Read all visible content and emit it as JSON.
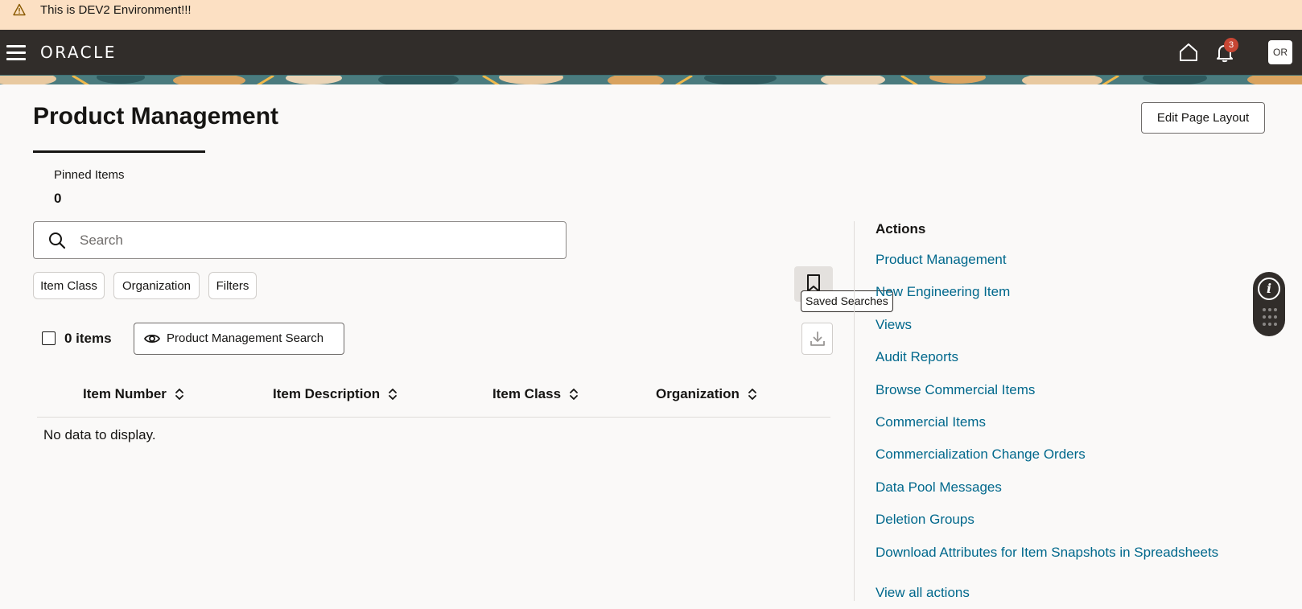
{
  "banner": {
    "text": "This is DEV2 Environment!!!"
  },
  "header": {
    "logo": "ORACLE",
    "notification_count": "3",
    "user_initials": "OR"
  },
  "page": {
    "title": "Product Management",
    "edit_layout_label": "Edit Page Layout"
  },
  "pinned": {
    "label": "Pinned Items",
    "count": "0"
  },
  "search": {
    "placeholder": "Search"
  },
  "filters": {
    "item_class": "Item Class",
    "organization": "Organization",
    "filters": "Filters"
  },
  "saved_searches": {
    "tooltip": "Saved Searches"
  },
  "results": {
    "count_label": "0 items",
    "view_label": "Product Management Search"
  },
  "table": {
    "columns": [
      "Item Number",
      "Item Description",
      "Item Class",
      "Organization"
    ],
    "empty_text": "No data to display."
  },
  "actions": {
    "title": "Actions",
    "links": [
      "Product Management",
      "New Engineering Item",
      "Views",
      "Audit Reports",
      "Browse Commercial Items",
      "Commercial Items",
      "Commercialization Change Orders",
      "Data Pool Messages",
      "Deletion Groups",
      "Download Attributes for Item Snapshots in Spreadsheets"
    ],
    "view_all": "View all actions"
  },
  "colors": {
    "header_bg": "#312d2a",
    "banner_bg": "#fce0c3",
    "link": "#00688c",
    "badge": "#c74634"
  },
  "icons": [
    "warning-icon",
    "hamburger-menu-icon",
    "home-icon",
    "bell-icon",
    "search-icon",
    "bookmark-icon",
    "eye-icon",
    "download-icon",
    "sort-icon",
    "info-icon",
    "grid-dots-icon"
  ]
}
